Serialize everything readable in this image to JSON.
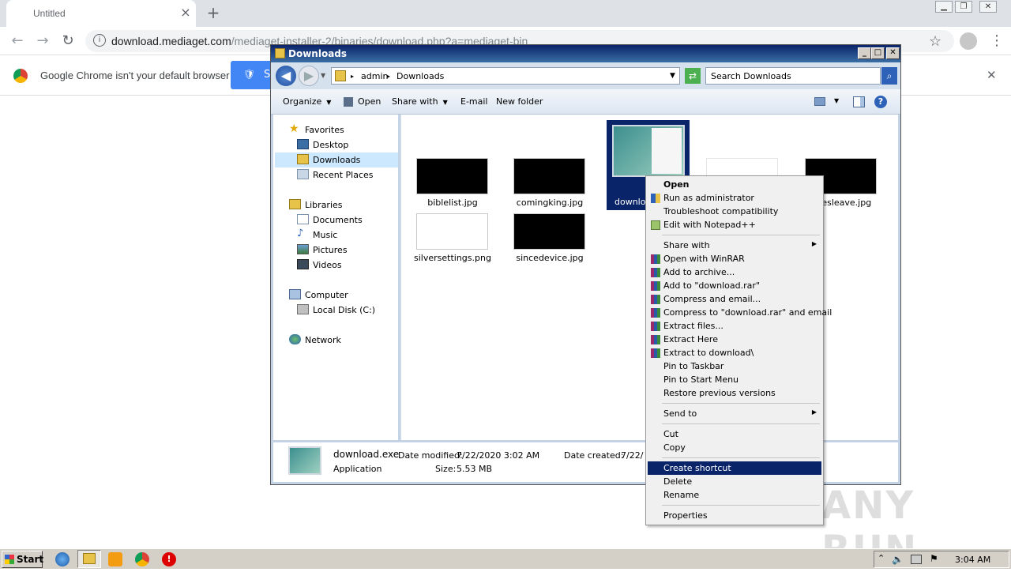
{
  "browser": {
    "tab_title": "Untitled",
    "tab_close": "×",
    "new_tab": "+",
    "url_host": "download.mediaget.com",
    "url_path": "/mediaget-installer-2/binaries/download.php?a=mediaget-bin",
    "infobar_text": "Google Chrome isn't your default browser",
    "infobar_button": "S",
    "infobar_close": "✕",
    "nav_back": "←",
    "nav_forward": "→",
    "nav_reload": "↻",
    "star": "☆",
    "menu": "⋮"
  },
  "explorer": {
    "title": "Downloads",
    "breadcrumb": [
      "admin",
      "Downloads"
    ],
    "search_placeholder": "Search Downloads",
    "commands": {
      "organize": "Organize",
      "open": "Open",
      "share_with": "Share with",
      "email": "E-mail",
      "new_folder": "New folder"
    },
    "nav": {
      "favorites": "Favorites",
      "desktop": "Desktop",
      "downloads": "Downloads",
      "recent_places": "Recent Places",
      "libraries": "Libraries",
      "documents": "Documents",
      "music": "Music",
      "pictures": "Pictures",
      "videos": "Videos",
      "computer": "Computer",
      "local_disk": "Local Disk (C:)",
      "network": "Network"
    },
    "files": {
      "biblelist": "biblelist.jpg",
      "comingking": "comingking.jpg",
      "download_partial": "downlo",
      "firesleave_partial": "iresleave.jpg",
      "silversettings": "silversettings.png",
      "sincedevice": "sincedevice.jpg"
    },
    "details": {
      "name": "download.exe",
      "type": "Application",
      "modified_label": "Date modified:",
      "modified_value": "7/22/2020 3:02 AM",
      "size_label": "Size:",
      "size_value": "5.53 MB",
      "created_label": "Date created:",
      "created_value": "7/22/"
    }
  },
  "context_menu": {
    "open": "Open",
    "run_as_admin": "Run as administrator",
    "troubleshoot": "Troubleshoot compatibility",
    "edit_notepad": "Edit with Notepad++",
    "share_with": "Share with",
    "open_winrar": "Open with WinRAR",
    "add_archive": "Add to archive...",
    "add_download_rar": "Add to \"download.rar\"",
    "compress_email": "Compress and email...",
    "compress_download_email": "Compress to \"download.rar\" and email",
    "extract_files": "Extract files...",
    "extract_here": "Extract Here",
    "extract_to": "Extract to download\\",
    "pin_taskbar": "Pin to Taskbar",
    "pin_start": "Pin to Start Menu",
    "restore": "Restore previous versions",
    "send_to": "Send to",
    "cut": "Cut",
    "copy": "Copy",
    "create_shortcut": "Create shortcut",
    "delete": "Delete",
    "rename": "Rename",
    "properties": "Properties"
  },
  "watermark": "ANY RUN",
  "taskbar": {
    "start": "Start",
    "clock": "3:04 AM"
  }
}
